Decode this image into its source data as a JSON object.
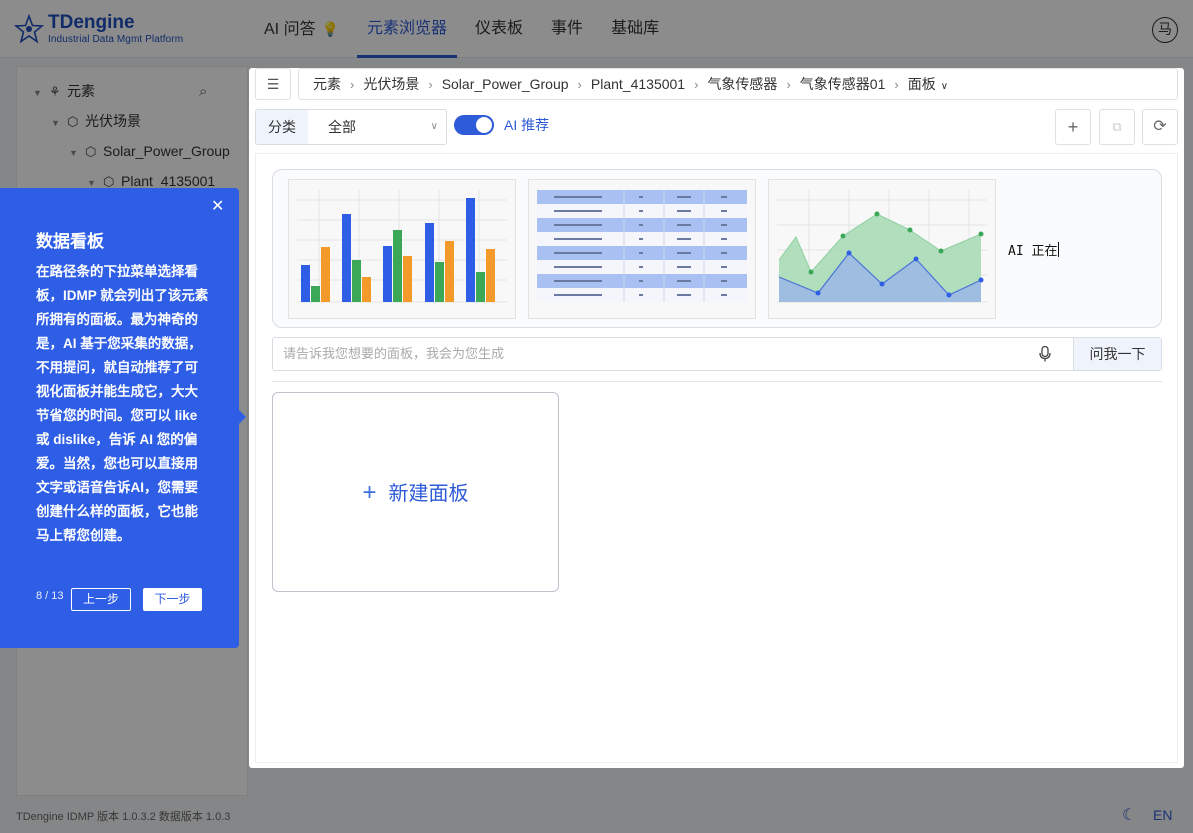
{
  "app": {
    "logo_title": "TDengine",
    "logo_subtitle": "Industrial Data Mgmt Platform",
    "avatar_text": "马"
  },
  "nav": {
    "items": [
      {
        "label": "AI 问答"
      },
      {
        "label": "元素浏览器"
      },
      {
        "label": "仪表板"
      },
      {
        "label": "事件"
      },
      {
        "label": "基础库"
      }
    ],
    "active_index": 1
  },
  "tree": {
    "items": [
      {
        "label": "元素"
      },
      {
        "label": "光伏场景"
      },
      {
        "label": "Solar_Power_Group"
      },
      {
        "label": "Plant_4135001"
      }
    ]
  },
  "breadcrumb": {
    "items": [
      "元素",
      "光伏场景",
      "Solar_Power_Group",
      "Plant_4135001",
      "气象传感器",
      "气象传感器01"
    ],
    "last": "面板"
  },
  "filter": {
    "label": "分类",
    "value": "全部"
  },
  "ai_recommend": {
    "label": "AI 推荐",
    "enabled": true
  },
  "suggestions": {
    "typing_text": "AI 正在"
  },
  "ask": {
    "placeholder": "请告诉我您想要的面板，我会为您生成",
    "button_label": "问我一下"
  },
  "new_panel": {
    "label": "新建面板"
  },
  "tour": {
    "title": "数据看板",
    "body": "在路径条的下拉菜单选择看板，IDMP 就会列出了该元素所拥有的面板。最为神奇的是，AI 基于您采集的数据，不用提问，就自动推荐了可视化面板并能生成它，大大节省您的时间。您可以 like 或 dislike，告诉 AI 您的偏爱。当然，您也可以直接用文字或语音告诉AI，您需要创建什么样的面板，它也能马上帮您创建。",
    "step": "8 / 13",
    "prev_label": "上一步",
    "next_label": "下一步"
  },
  "footer": {
    "version": "TDengine IDMP 版本 1.0.3.2 数据版本 1.0.3",
    "lang": "EN"
  },
  "colors": {
    "primary": "#2e5bd8",
    "tour_bg": "#2f5ee6"
  }
}
